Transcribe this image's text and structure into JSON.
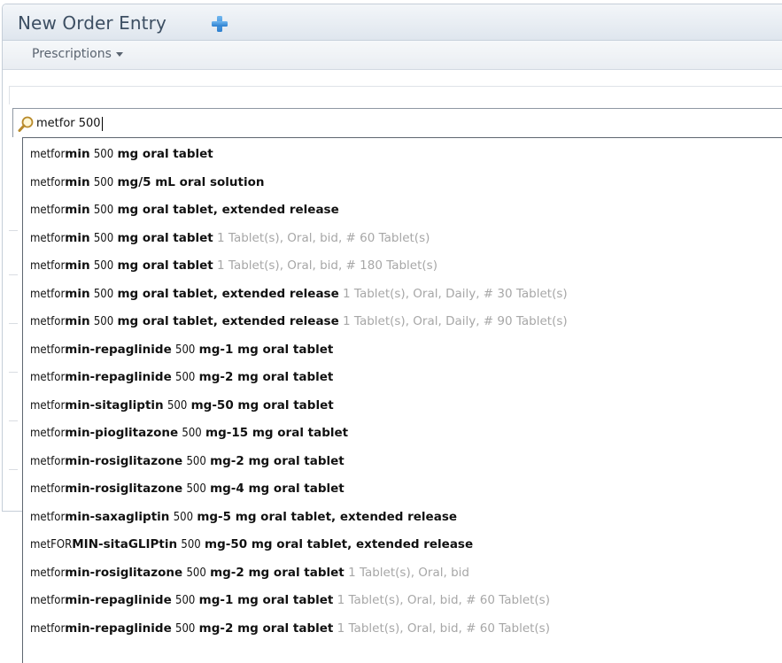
{
  "header": {
    "title": "New Order Entry",
    "add_icon": "plus-icon",
    "accent_color": "#3a8fd6"
  },
  "toolbar": {
    "prescriptions_label": "Prescriptions"
  },
  "search": {
    "icon": "magnifier-icon",
    "value": "metfor 500"
  },
  "suggestions": [
    {
      "prefix": "metfor",
      "match": "min",
      "dose": "500",
      "form": "mg oral tablet",
      "details": ""
    },
    {
      "prefix": "metfor",
      "match": "min",
      "dose": "500",
      "form": "mg/5 mL oral solution",
      "details": ""
    },
    {
      "prefix": "metfor",
      "match": "min",
      "dose": "500",
      "form": "mg oral tablet, extended release",
      "details": ""
    },
    {
      "prefix": "metfor",
      "match": "min",
      "dose": "500",
      "form": "mg oral tablet",
      "details": "1 Tablet(s), Oral, bid, # 60 Tablet(s)"
    },
    {
      "prefix": "metfor",
      "match": "min",
      "dose": "500",
      "form": "mg oral tablet",
      "details": "1 Tablet(s), Oral, bid, # 180 Tablet(s)"
    },
    {
      "prefix": "metfor",
      "match": "min",
      "dose": "500",
      "form": "mg oral tablet, extended release",
      "details": "1 Tablet(s), Oral, Daily, # 30 Tablet(s)"
    },
    {
      "prefix": "metfor",
      "match": "min",
      "dose": "500",
      "form": "mg oral tablet, extended release",
      "details": "1 Tablet(s), Oral, Daily, # 90 Tablet(s)"
    },
    {
      "prefix": "metfor",
      "match": "min-repaglinide",
      "dose": "500",
      "form": "mg-1 mg oral tablet",
      "details": ""
    },
    {
      "prefix": "metfor",
      "match": "min-repaglinide",
      "dose": "500",
      "form": "mg-2 mg oral tablet",
      "details": ""
    },
    {
      "prefix": "metfor",
      "match": "min-sitagliptin",
      "dose": "500",
      "form": "mg-50 mg oral tablet",
      "details": ""
    },
    {
      "prefix": "metfor",
      "match": "min-pioglitazone",
      "dose": "500",
      "form": "mg-15 mg oral tablet",
      "details": ""
    },
    {
      "prefix": "metfor",
      "match": "min-rosiglitazone",
      "dose": "500",
      "form": "mg-2 mg oral tablet",
      "details": ""
    },
    {
      "prefix": "metfor",
      "match": "min-rosiglitazone",
      "dose": "500",
      "form": "mg-4 mg oral tablet",
      "details": ""
    },
    {
      "prefix": "metfor",
      "match": "min-saxagliptin",
      "dose": "500",
      "form": "mg-5 mg oral tablet, extended release",
      "details": ""
    },
    {
      "prefix": "metFOR",
      "match": "MIN-sitaGLIPtin",
      "dose": "500",
      "form": "mg-50 mg oral tablet, extended release",
      "details": ""
    },
    {
      "prefix": "metfor",
      "match": "min-rosiglitazone",
      "dose": "500",
      "form": "mg-2 mg oral tablet",
      "details": "1 Tablet(s), Oral, bid"
    },
    {
      "prefix": "metfor",
      "match": "min-repaglinide",
      "dose": "500",
      "form": "mg-1 mg oral tablet",
      "details": "1 Tablet(s), Oral, bid, # 60 Tablet(s)"
    },
    {
      "prefix": "metfor",
      "match": "min-repaglinide",
      "dose": "500",
      "form": "mg-2 mg oral tablet",
      "details": "1 Tablet(s), Oral, bid, # 60 Tablet(s)"
    }
  ]
}
